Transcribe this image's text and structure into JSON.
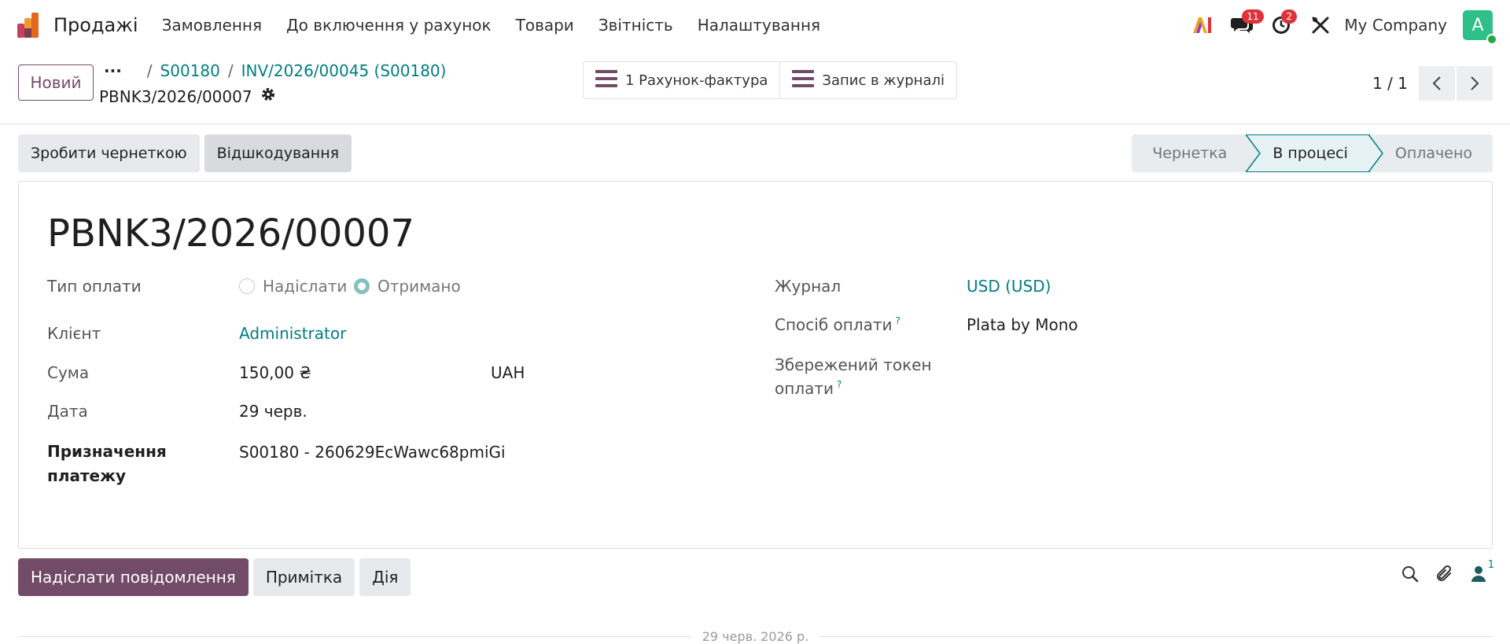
{
  "app": {
    "name": "Продажі"
  },
  "menu": [
    "Замовлення",
    "До включення у рахунок",
    "Товари",
    "Звітність",
    "Налаштування"
  ],
  "systray": {
    "messages_count": "11",
    "activities_count": "2",
    "company": "My Company",
    "avatar_letter": "A"
  },
  "control_panel": {
    "new_label": "Новий",
    "dots": "···",
    "breadcrumb": [
      "S00180",
      "INV/2026/00045 (S00180)"
    ],
    "record_name": "PBNK3/2026/00007",
    "smart_buttons": [
      "1 Рахунок-фактура",
      "Запис в журналі"
    ],
    "pager": "1 / 1"
  },
  "actions": [
    "Зробити чернеткою",
    "Відшкодування"
  ],
  "status": {
    "stages": [
      "Чернетка",
      "В процесі",
      "Оплачено"
    ],
    "current": "В процесі"
  },
  "form": {
    "title": "PBNK3/2026/00007",
    "payment_type": {
      "label": "Тип оплати",
      "options": [
        "Надіслати",
        "Отримано"
      ],
      "selected": "Отримано"
    },
    "customer": {
      "label": "Клієнт",
      "value": "Administrator"
    },
    "amount": {
      "label": "Сума",
      "value": "150,00 ₴",
      "currency": "UAH"
    },
    "date": {
      "label": "Дата",
      "value": "29 черв."
    },
    "memo": {
      "label_line1": "Призначення",
      "label_line2": "платежу",
      "value": "S00180 - 260629EcWawc68pmiGi"
    },
    "journal": {
      "label": "Журнал",
      "value": "USD (USD)"
    },
    "method": {
      "label": "Спосіб оплати",
      "help": "?",
      "value": "Plata by Mono"
    },
    "token": {
      "label_line1": "Збережений токен",
      "label_line2": "оплати",
      "help": "?"
    }
  },
  "chatter": {
    "buttons": [
      "Надіслати повідомлення",
      "Примітка",
      "Дія"
    ],
    "followers": "1",
    "date_separator": "29 черв. 2026 р."
  },
  "colors": {
    "brand": "#714b67",
    "link": "#017e84",
    "badge": "#e0323c"
  }
}
